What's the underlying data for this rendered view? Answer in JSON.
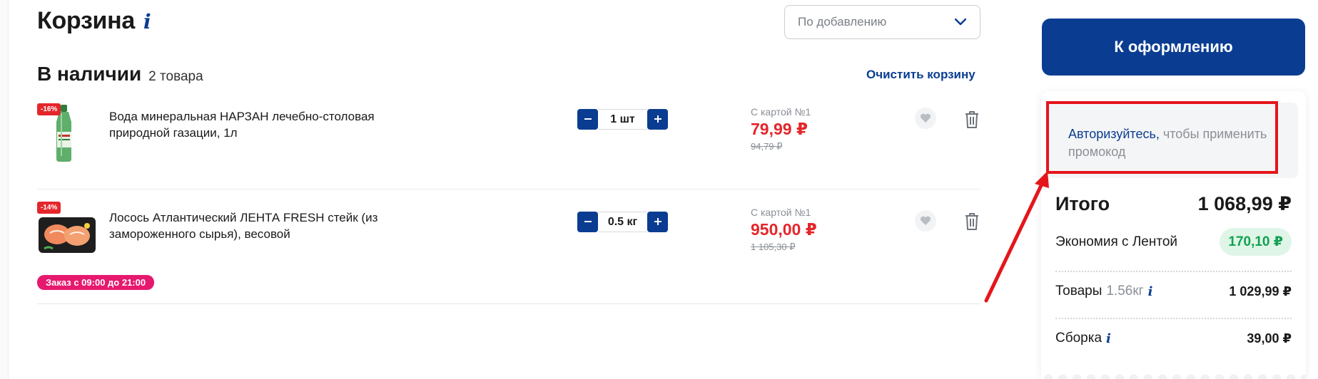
{
  "page": {
    "title": "Корзина",
    "title_info": "i"
  },
  "sort": {
    "value": "По добавлению"
  },
  "section": {
    "title": "В наличии",
    "count": "2 товара",
    "clear_label": "Очистить корзину"
  },
  "items": [
    {
      "discount": "-16%",
      "name": "Вода минеральная НАРЗАН лечебно-столовая природной газации, 1л",
      "qty": "1 шт",
      "card_label": "С картой №1",
      "price": "79,99 ₽",
      "old_price": "94,79 ₽"
    },
    {
      "discount": "-14%",
      "name": "Лосось Атлантический ЛЕНТА FRESH стейк (из замороженного сырья), весовой",
      "qty": "0.5 кг",
      "card_label": "С картой №1",
      "price": "950,00 ₽",
      "old_price": "1 105,30 ₽"
    }
  ],
  "order_badge": "Заказ с 09:00 до 21:00",
  "checkout": {
    "label": "К оформлению"
  },
  "promo": {
    "link": "Авторизуйтесь,",
    "rest": " чтобы применить промокод"
  },
  "summary": {
    "total_label": "Итого",
    "total_value": "1 068,99 ₽",
    "economy_label": "Экономия с Лентой",
    "economy_value": "170,10 ₽",
    "goods_label": "Товары",
    "goods_weight": "1.56кг",
    "goods_value": "1 029,99 ₽",
    "assembly_label": "Сборка",
    "assembly_value": "39,00 ₽",
    "info": "i"
  },
  "colors": {
    "brand_blue": "#0a3d91",
    "price_red": "#e4262b",
    "badge_pink": "#e6196f",
    "economy_green": "#12a150",
    "highlight_red": "#e4161b"
  }
}
